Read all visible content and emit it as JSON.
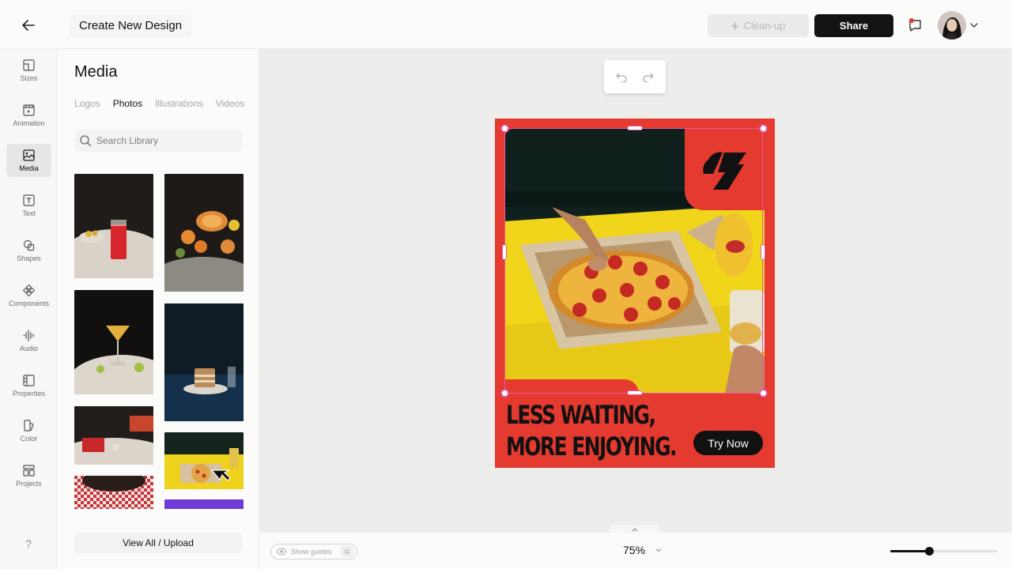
{
  "topbar": {
    "back_icon": "arrow-left-icon",
    "title": "Create New Design",
    "cleanup_label": "Clean-up",
    "cleanup_icon": "lightning-icon",
    "share_label": "Share",
    "comment_icon": "comment-icon",
    "notification_color": "#e53a2f",
    "avatar_chevron_icon": "chevron-down-icon"
  },
  "rail": {
    "items": [
      {
        "label": "Sizes",
        "icon": "sizes-icon"
      },
      {
        "label": "Animation",
        "icon": "animation-icon"
      },
      {
        "label": "Media",
        "icon": "media-icon",
        "active": true
      },
      {
        "label": "Text",
        "icon": "text-icon"
      },
      {
        "label": "Shapes",
        "icon": "shapes-icon"
      },
      {
        "label": "Components",
        "icon": "components-icon"
      },
      {
        "label": "Audio",
        "icon": "audio-icon"
      },
      {
        "label": "Properties",
        "icon": "properties-icon"
      },
      {
        "label": "Color",
        "icon": "color-icon"
      },
      {
        "label": "Projects",
        "icon": "projects-icon"
      }
    ],
    "help_label": "?"
  },
  "panel": {
    "title": "Media",
    "tabs": [
      {
        "label": "Logos"
      },
      {
        "label": "Photos",
        "active": true
      },
      {
        "label": "Illustrations"
      },
      {
        "label": "Videos"
      }
    ],
    "search_placeholder": "Search Library",
    "view_all_label": "View All / Upload"
  },
  "design": {
    "headline_line1": "LESS WAITING,",
    "headline_line2": "MORE ENJOYING.",
    "cta_label": "Try Now",
    "background_color": "#e53a2f"
  },
  "bottombar": {
    "show_guides_label": "Show guides",
    "show_guides_shortcut": "G",
    "zoom_label": "75%",
    "zoom_slider_value": 0.36
  },
  "colors": {
    "accent": "#e53a2f",
    "selection": "#e05aa4",
    "dark": "#131313"
  }
}
